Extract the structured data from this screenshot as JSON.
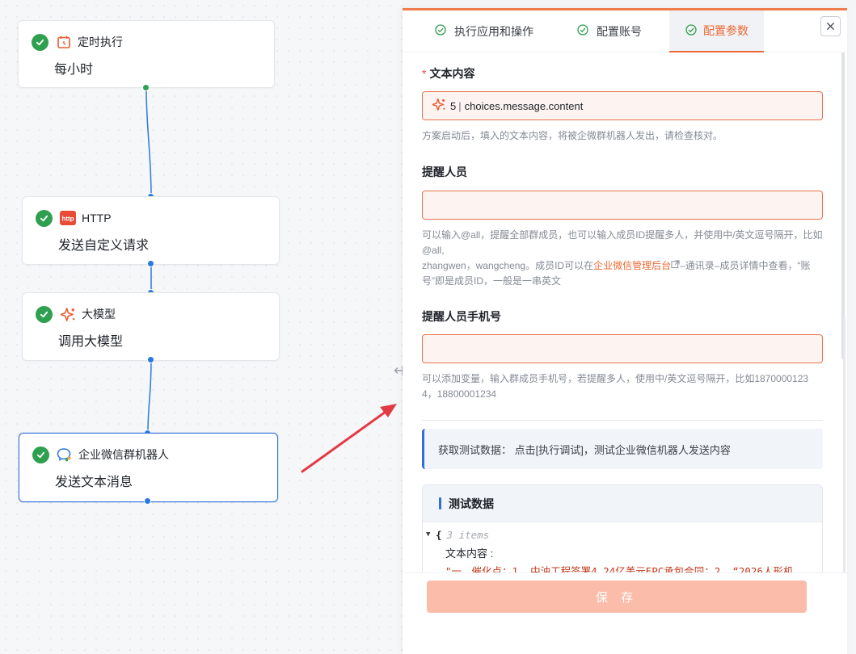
{
  "canvas": {
    "nodes": [
      {
        "app": "定时执行",
        "action": "每小时",
        "icon": "calendar-clock-icon",
        "status": "success"
      },
      {
        "app": "HTTP",
        "action": "发送自定义请求",
        "icon": "http-icon",
        "status": "success"
      },
      {
        "app": "大模型",
        "action": "调用大模型",
        "icon": "sparkle-icon",
        "status": "success"
      },
      {
        "app": "企业微信群机器人",
        "action": "发送文本消息",
        "icon": "wecom-robot-icon",
        "status": "success",
        "selected": true
      }
    ]
  },
  "panel": {
    "tabs": [
      {
        "label": "执行应用和操作",
        "active": false
      },
      {
        "label": "配置账号",
        "active": false
      },
      {
        "label": "配置参数",
        "active": true
      }
    ],
    "fields": {
      "text_content": {
        "label": "文本内容",
        "required": true,
        "token_index": "5",
        "token_path": "choices.message.content",
        "hint": "方案启动后，填入的文本内容，将被企微群机器人发出，请检查核对。"
      },
      "mention_members": {
        "label": "提醒人员",
        "value": "",
        "hint_line1": "可以输入@all，提醒全部群成员，也可以输入成员ID提醒多人，并使用中/英文逗号隔开，比如",
        "hint_line2": "@all,",
        "hint_line3_pre": "zhangwen，wangcheng。成员ID可以在",
        "hint_link": "企业微信管理后台",
        "hint_line3_post": "–通讯录–成员详情中查看，“账",
        "hint_line4": "号”即是成员ID，一般是一串英文"
      },
      "mention_mobiles": {
        "label": "提醒人员手机号",
        "value": "",
        "hint_line1": "可以添加变量，输入群成员手机号，若提醒多人，使用中/英文逗号隔开，比如1870000123",
        "hint_line2": "4，18800001234"
      }
    },
    "test_tip": "获取测试数据：  点击[执行调试]，测试企业微信机器人发送内容",
    "test_data": {
      "title": "测试数据",
      "brace": "{",
      "items_count": "3 items",
      "key": "文本内容 :",
      "value_preview": "\"一、催化点：1. 中油工程签署4.24亿美元EPC承包合同；2. “2026人形机"
    },
    "save_label": "保 存"
  },
  "colors": {
    "accent": "#ea6a35",
    "success": "#2ea04f",
    "link_blue": "#2a78e0",
    "arrow_red": "#e23b45"
  }
}
